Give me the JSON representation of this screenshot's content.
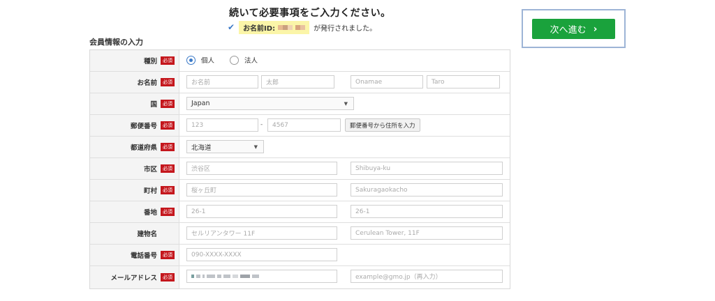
{
  "header": {
    "title": "続いて必要事項をご入力ください。",
    "id_label": "お名前ID:",
    "id_suffix": "が発行されました。"
  },
  "next_button": {
    "label": "次へ進む"
  },
  "section_title": "会員情報の入力",
  "required_badge": "必須",
  "rows": {
    "type": {
      "label": "種別",
      "options": [
        "個人",
        "法人"
      ],
      "selected": "個人"
    },
    "name": {
      "label": "お名前",
      "placeholders": [
        "お名前",
        "太郎",
        "Onamae",
        "Taro"
      ]
    },
    "country": {
      "label": "国",
      "value": "Japan"
    },
    "postal": {
      "label": "郵便番号",
      "placeholders": [
        "123",
        "4567"
      ],
      "dash": "-",
      "lookup_button": "郵便番号から住所を入力"
    },
    "prefecture": {
      "label": "都道府県",
      "value": "北海道"
    },
    "city": {
      "label": "市区",
      "placeholders": [
        "渋谷区",
        "Shibuya-ku"
      ]
    },
    "town": {
      "label": "町村",
      "placeholders": [
        "桜ヶ丘町",
        "Sakuragaokacho"
      ]
    },
    "street": {
      "label": "番地",
      "placeholders": [
        "26-1",
        "26-1"
      ]
    },
    "building": {
      "label": "建物名",
      "placeholders": [
        "セルリアンタワー 11F",
        "Cerulean Tower, 11F"
      ]
    },
    "phone": {
      "label": "電話番号",
      "placeholder": "090-XXXX-XXXX"
    },
    "email": {
      "label": "メールアドレス",
      "confirm_placeholder": "example@gmo.jp（再入力）"
    }
  },
  "colors": {
    "accent_green": "#1aa23c",
    "required_red": "#c4161c",
    "radio_blue": "#3a79c7",
    "highlight_yellow": "#fbf5a8"
  }
}
